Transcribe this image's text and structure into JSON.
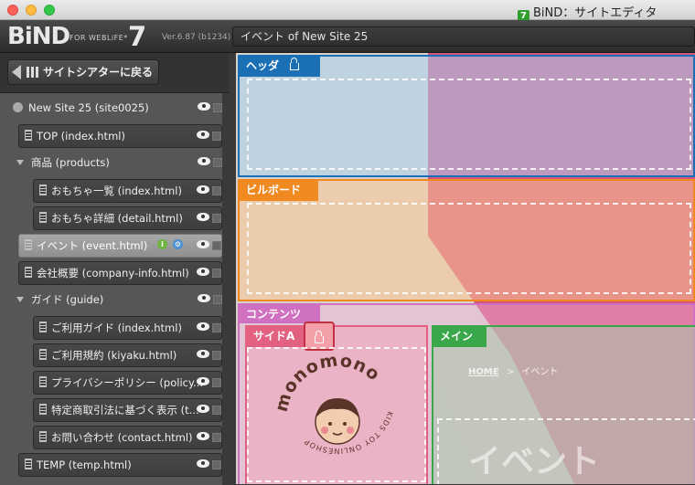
{
  "window": {
    "title": "BiND：サイトエディタ",
    "app_icon_label": "7"
  },
  "header": {
    "logo": "BiND",
    "logo_sub": "FOR WEBLiFE*",
    "logo_version_num": "7",
    "version": "Ver.6.87 (b1234)",
    "site_title": "イベント of New Site 25"
  },
  "sidebar": {
    "back_button": "サイトシアターに戻る",
    "items": [
      {
        "label": "New Site 25 (site0025)",
        "type": "site"
      },
      {
        "label": "TOP (index.html)",
        "type": "page"
      },
      {
        "label": "商品 (products)",
        "type": "folder"
      },
      {
        "label": "おもちゃ一覧 (index.html)",
        "type": "page"
      },
      {
        "label": "おもちゃ詳細 (detail.html)",
        "type": "page"
      },
      {
        "label": "イベント (event.html)",
        "type": "page",
        "selected": true
      },
      {
        "label": "会社概要 (company-info.html)",
        "type": "page"
      },
      {
        "label": "ガイド (guide)",
        "type": "folder"
      },
      {
        "label": "ご利用ガイド (index.html)",
        "type": "page"
      },
      {
        "label": "ご利用規約 (kiyaku.html)",
        "type": "page"
      },
      {
        "label": "プライバシーポリシー (policy...",
        "type": "page"
      },
      {
        "label": "特定商取引法に基づく表示 (t...",
        "type": "page"
      },
      {
        "label": "お問い合わせ (contact.html)",
        "type": "page"
      },
      {
        "label": "TEMP (temp.html)",
        "type": "page"
      }
    ],
    "status_icons": {
      "info": "i",
      "gear": "⚙"
    }
  },
  "canvas": {
    "zones": {
      "header": "ヘッダ",
      "billboard": "ビルボード",
      "contents": "コンテンツ",
      "side_a": "サイドA",
      "main": "メイン"
    },
    "breadcrumb": {
      "home": "HOME",
      "sep": ">",
      "current": "イベント"
    },
    "page_heading": "イベント",
    "logo_text": "monomono",
    "logo_ring_text": "KIDS TOY ONLINESHOP",
    "colors": {
      "header": "#1a6fb5",
      "billboard": "#f08a20",
      "contents": "#d070c0",
      "side_a": "#e26080",
      "main": "#3aa84a"
    }
  }
}
